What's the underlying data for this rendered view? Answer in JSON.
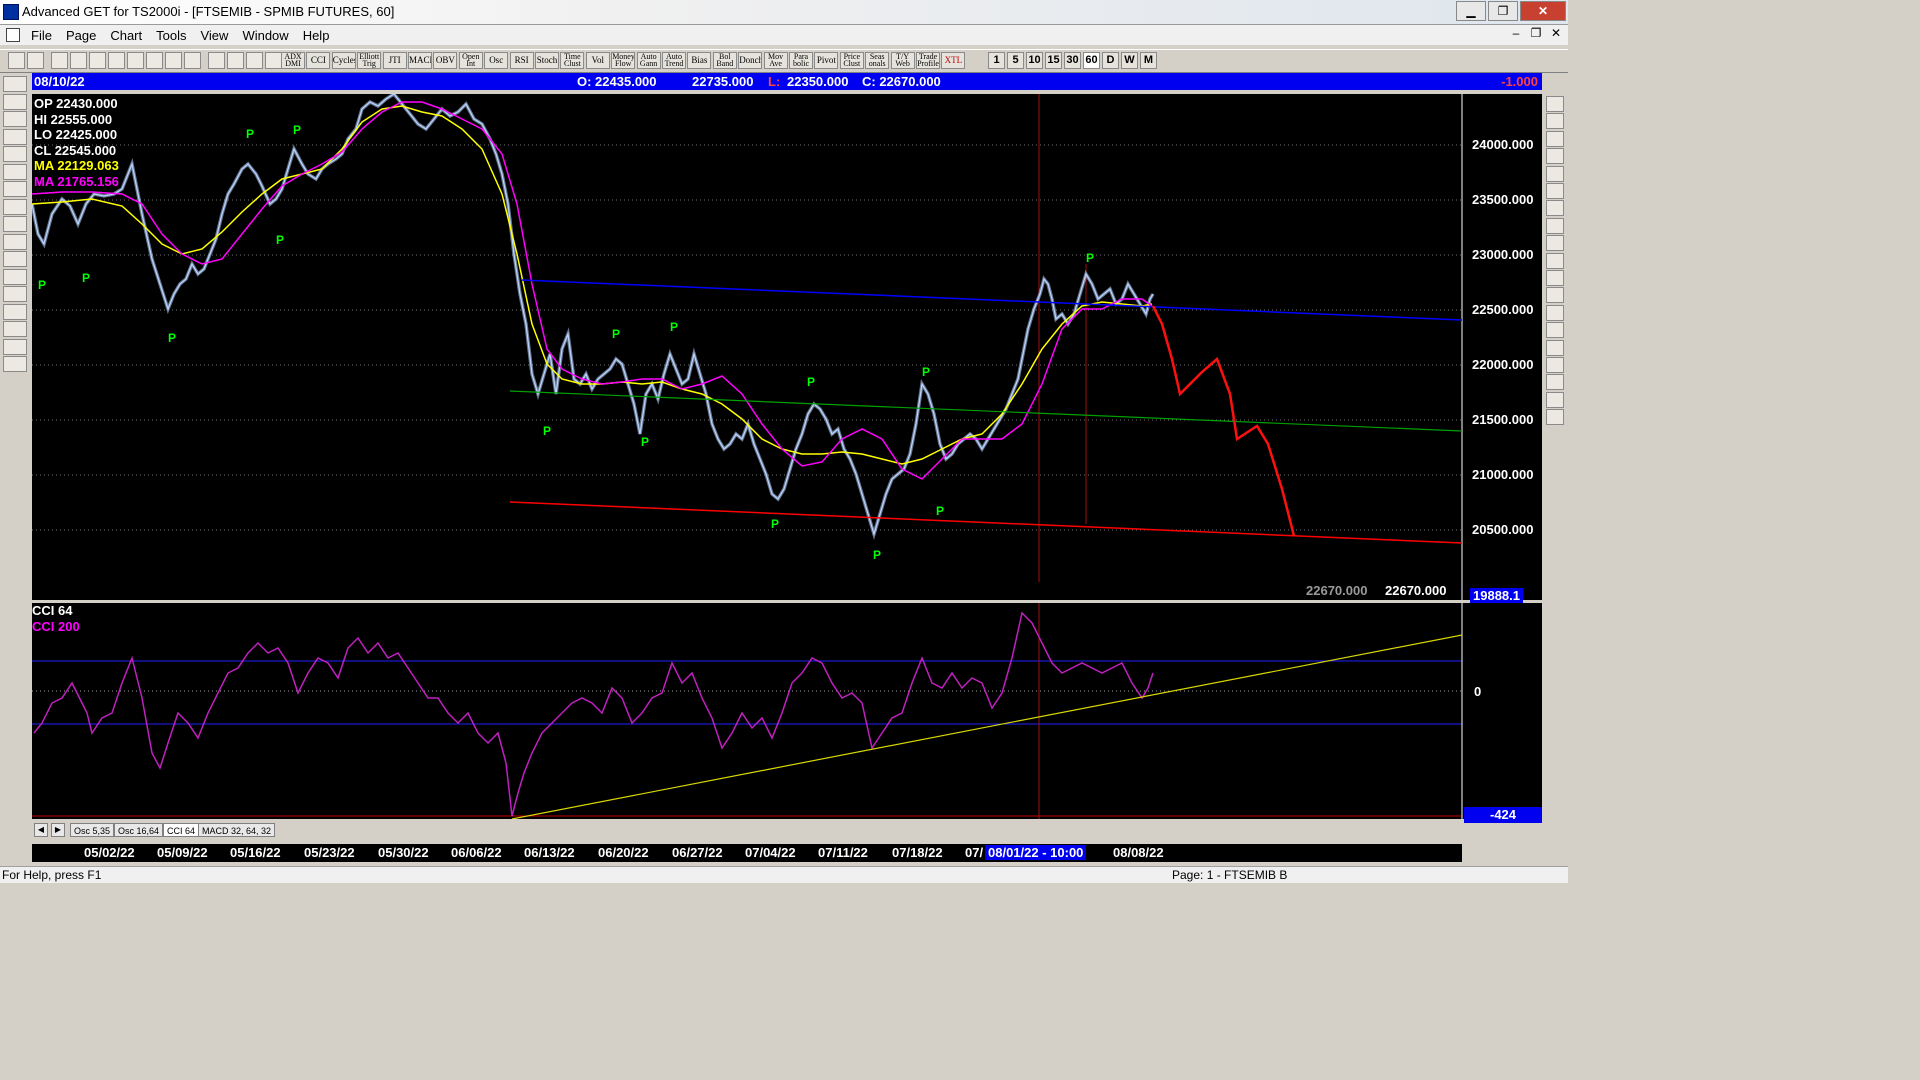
{
  "window": {
    "title": "Advanced GET for TS2000i - [FTSEMIB - SPMIB FUTURES, 60]"
  },
  "menu": [
    "File",
    "Page",
    "Chart",
    "Tools",
    "View",
    "Window",
    "Help"
  ],
  "toolbar": {
    "studies": [
      "ADX DMI",
      "CCI",
      "Cycles",
      "Elliott Trig",
      "JTI",
      "MACD",
      "OBV",
      "Open Int",
      "Osc",
      "RSI",
      "Stoch",
      "Time Clust",
      "Vol",
      "Money Flow",
      "Auto Gann",
      "Auto Trend",
      "Bias",
      "Bol Band",
      "Donch",
      "Mov Ave",
      "Para bolic",
      "Pivot",
      "Price Clust",
      "Seas onals",
      "T/Y Web",
      "Trade Profile",
      "XTL"
    ],
    "periods": [
      "1",
      "5",
      "10",
      "15",
      "30",
      "60",
      "D",
      "W",
      "M"
    ],
    "active_period": "60"
  },
  "infobar": {
    "date": "08/10/22",
    "open": "O: 22435.000",
    "high": "22735.000",
    "low_label": "L:",
    "low": "22350.000",
    "close": "C: 22670.000",
    "change": "-1.000"
  },
  "overlay": {
    "op": "OP  22430.000",
    "hi": "HI   22555.000",
    "lo": "LO  22425.000",
    "cl": "CL  22545.000",
    "ma1": "MA  22129.063",
    "ma2": "MA  21765.156"
  },
  "colors": {
    "ma_fast": "#ffff00",
    "ma_slow": "#ff00ff",
    "price": "#b8d4ff",
    "trend_blue": "#0000ff",
    "trend_green": "#00a000",
    "trend_red": "#ff0000",
    "pivot": "#00ff00"
  },
  "price_axis": {
    "labels": [
      "24000.000",
      "23500.000",
      "23000.000",
      "22500.000",
      "22000.000",
      "21500.000",
      "21000.000",
      "20500.000"
    ],
    "last_grey": "22670.000",
    "last": "22670.000",
    "cut": "19888.1"
  },
  "pivot_label": "P",
  "cci": {
    "title1": "CCI 64",
    "title2": "CCI  200",
    "zero": "0",
    "low": "-424"
  },
  "tabs": [
    "Osc 5,35",
    "Osc 16,64",
    "CCI 64",
    "MACD 32, 64, 32"
  ],
  "active_tab": "CCI 64",
  "dates": [
    "05/02/22",
    "05/09/22",
    "05/16/22",
    "05/23/22",
    "05/30/22",
    "06/06/22",
    "06/13/22",
    "06/20/22",
    "06/27/22",
    "07/04/22",
    "07/11/22",
    "07/18/22",
    "07/"
  ],
  "date_cursor": "08/01/22 - 10:00",
  "date_last": "08/08/22",
  "status": {
    "help": "For Help, press F1",
    "page": "Page: 1 - FTSEMIB B"
  }
}
